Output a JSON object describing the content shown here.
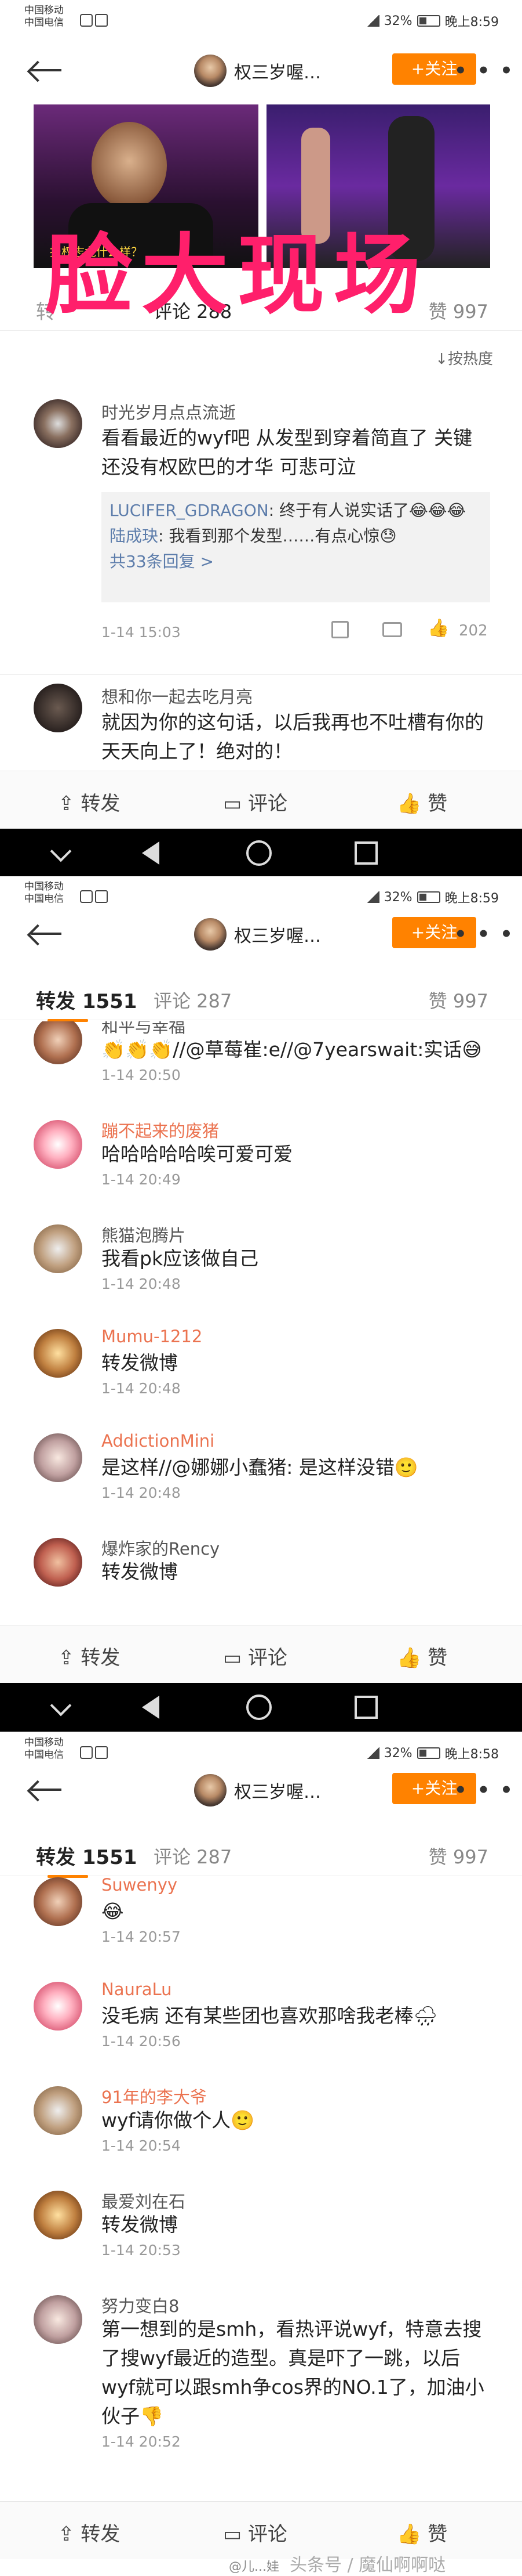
{
  "statusbar": {
    "carrier1": "中国移动",
    "carrier2": "中国电信",
    "shot1": {
      "battery": "32%",
      "time": "晚上8:59"
    },
    "shot2": {
      "battery": "32%",
      "time": "晚上8:59"
    },
    "shot3": {
      "battery": "32%",
      "time": "晚上8:58"
    }
  },
  "header": {
    "name": "权三岁喔…",
    "follow": "+关注"
  },
  "shot1": {
    "video_caption": "报权志龙什么样？",
    "tab_left": "转",
    "tab_mid": "评论 288",
    "tab_right": "赞 997",
    "sort": "按热度",
    "banner": "脸大现场",
    "c1": {
      "name": "时光岁月点点流逝",
      "text": "看看最近的wyf吧 从发型到穿着简直了 关键还没有权欧巴的才华 可悲可泣",
      "r1_user": "LUCIFER_GDRAGON",
      "r1_text": ": 终于有人说实话了😂😂😂",
      "r2_user": "陆成玦",
      "r2_text": ": 我看到那个发型……有点心惊😓",
      "more": "共33条回复 >",
      "time": "1-14 15:03",
      "likes": "202"
    },
    "c2": {
      "name": "想和你一起去吃月亮",
      "text": "就因为你的这句话，以后我再也不吐槽有你的天天向上了！绝对的！"
    }
  },
  "bar": {
    "repost": "转发",
    "comment": "评论",
    "like": "赞"
  },
  "tabs": {
    "repost": "转发 1551",
    "comment": "评论 287",
    "like": "赞 997"
  },
  "shot2": {
    "items": [
      {
        "name": "和平与幸福",
        "text": "👏👏👏//@草莓崔:e//@7yearswait:实话😅",
        "time": "1-14 20:50"
      },
      {
        "name": "蹦不起来的废猪",
        "text": "哈哈哈哈哈唉可爱可爱",
        "time": "1-14 20:49"
      },
      {
        "name": "熊猫泡腾片",
        "text": "我看pk应该做自己",
        "time": "1-14 20:48"
      },
      {
        "name": "Mumu-1212",
        "text": "转发微博",
        "time": "1-14 20:48"
      },
      {
        "name": "AddictionMini",
        "text": "是这样//@娜娜小蠢猪: 是这样没错🙂",
        "time": "1-14 20:48"
      },
      {
        "name": "爆炸家的Rency",
        "text": "转发微博",
        "time": ""
      }
    ]
  },
  "shot3": {
    "items": [
      {
        "name": "Suwenyy",
        "text": "😂",
        "time": "1-14 20:57"
      },
      {
        "name": "NauraLu",
        "text": "没毛病 还有某些团也喜欢那啥我老棒🌧",
        "time": "1-14 20:56"
      },
      {
        "name": "91年的李大爷",
        "text": "wyf请你做个人🙂",
        "time": "1-14 20:54"
      },
      {
        "name": "最爱刘在石",
        "text": "转发微博",
        "time": "1-14 20:53"
      },
      {
        "name": "努力变白8",
        "text": "第一想到的是smh，看热评说wyf，特意去搜了搜wyf最近的造型。真是吓了一跳，以后wyf就可以跟smh争cos界的NO.1了，加油小伙子👎",
        "time": "1-14 20:52"
      }
    ]
  },
  "watermark": "头条号 / 魔仙啊啊哒",
  "footer_mark": "@儿...娃"
}
